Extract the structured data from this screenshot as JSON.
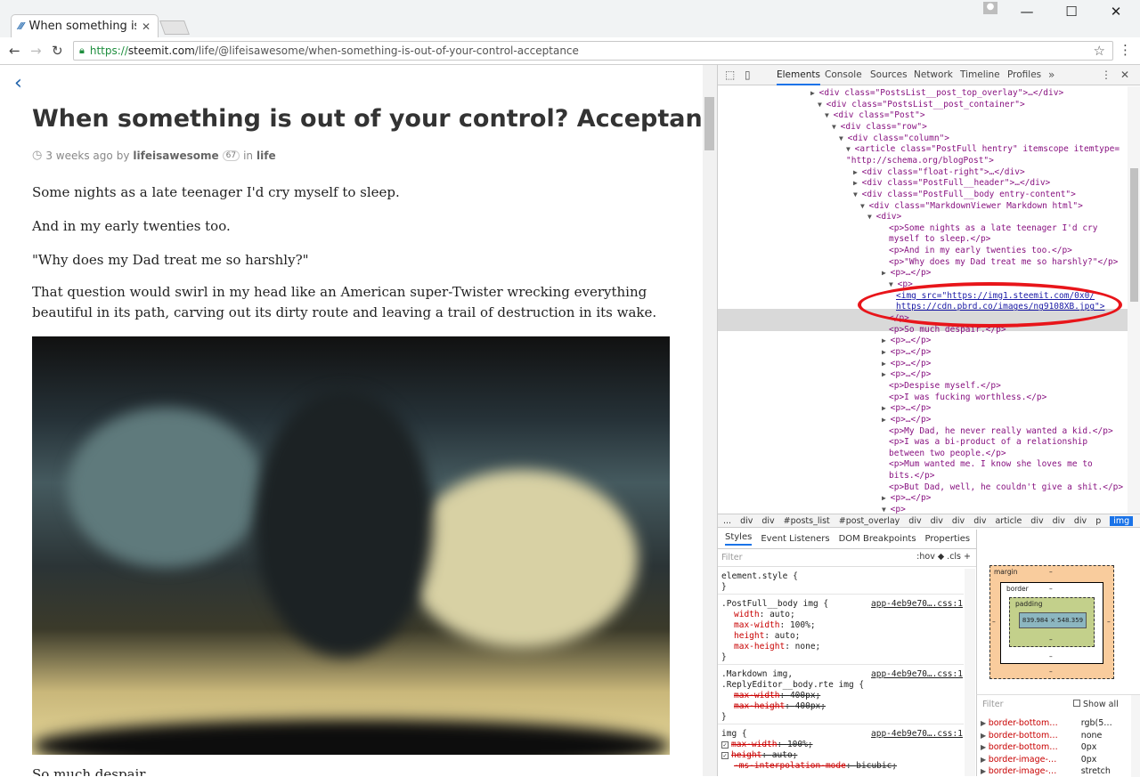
{
  "browser": {
    "tab_title": "When something is",
    "tab_favicon": "steemit-icon",
    "url_scheme": "https://",
    "url_host": "steemit.com",
    "url_path": "/life/@lifeisawesome/when-something-is-out-of-your-control-acceptance"
  },
  "post": {
    "title": "When something is out of your control? Acceptance.",
    "time": "3 weeks ago",
    "by": "by",
    "author": "lifeisawesome",
    "reputation": "67",
    "in": "in",
    "category": "life",
    "paragraphs": [
      "Some nights as a late teenager I'd cry myself to sleep.",
      "And in my early twenties too.",
      "\"Why does my Dad treat me so harshly?\"",
      "That question would swirl in my head like an American super-Twister wrecking everything beautiful in its path, carving out its dirty route and leaving a trail of destruction in its wake."
    ],
    "after_image": "So much despair"
  },
  "devtools": {
    "tabs": [
      "Elements",
      "Console",
      "Sources",
      "Network",
      "Timeline",
      "Profiles"
    ],
    "active_tab": "Elements",
    "dom": [
      {
        "t": "<div class=\"PostsList__post_top_overlay\">…</div>"
      },
      {
        "t": "<div class=\"PostsList__post_container\">"
      },
      {
        "t": "<div class=\"Post\">"
      },
      {
        "t": "<div class=\"row\">"
      },
      {
        "t": "<div class=\"column\">"
      },
      {
        "t": "<article class=\"PostFull hentry\" itemscope itemtype="
      },
      {
        "t": "\"http://schema.org/blogPost\">"
      },
      {
        "t": "<div class=\"float-right\">…</div>"
      },
      {
        "t": "<div class=\"PostFull__header\">…</div>"
      },
      {
        "t": "<div class=\"PostFull__body entry-content\">"
      },
      {
        "t": "<div class=\"MarkdownViewer Markdown html\">"
      },
      {
        "t": "<div>"
      },
      {
        "t": "<p>Some nights as a late teenager I'd cry"
      },
      {
        "t": "myself to sleep.</p>"
      },
      {
        "t": "<p>And in my early twenties too.</p>"
      },
      {
        "t": "<p>\"Why does my Dad treat me so harshly?\"</p>"
      },
      {
        "t": "<p>…</p>"
      },
      {
        "t": "<p>"
      },
      {
        "t": "<img src=\"https://img1.steemit.com/0x0/"
      },
      {
        "t": "https://cdn.pbrd.co/images/ng9108XB.jpg\">"
      },
      {
        "t": "</p>"
      },
      {
        "t": "<p>So much despair.</p>"
      },
      {
        "t": "<p>…</p>"
      },
      {
        "t": "<p>…</p>"
      },
      {
        "t": "<p>…</p>"
      },
      {
        "t": "<p>…</p>"
      },
      {
        "t": "<p>Despise myself.</p>"
      },
      {
        "t": "<p>I was fucking worthless.</p>"
      },
      {
        "t": "<p>…</p>"
      },
      {
        "t": "<p>…</p>"
      },
      {
        "t": "<p>My Dad, he never really wanted a kid.</p>"
      },
      {
        "t": "<p>I was a bi-product of a relationship"
      },
      {
        "t": "between two people.</p>"
      },
      {
        "t": "<p>Mum wanted me. I know she loves me to"
      },
      {
        "t": "bits.</p>"
      },
      {
        "t": "<p>But Dad, well, he couldn't give a shit.</p>"
      },
      {
        "t": "<p>…</p>"
      },
      {
        "t": "<p>"
      }
    ],
    "breadcrumbs": [
      "...",
      "div",
      "div",
      "#posts_list",
      "#post_overlay",
      "div",
      "div",
      "div",
      "div",
      "article",
      "div",
      "div",
      "div",
      "p",
      "img"
    ],
    "subtabs": [
      "Styles",
      "Event Listeners",
      "DOM Breakpoints",
      "Properties"
    ],
    "filter_placeholder": "Filter",
    "filter_tools": ":hov  ◆  .cls  +",
    "styles": [
      {
        "selector": "element.style {",
        "src": ""
      },
      {
        "selector": ".PostFull__body img {",
        "src": "app-4eb9e70….css:1"
      },
      {
        "selector": ".Markdown img,",
        "src": "app-4eb9e70….css:1"
      },
      {
        "selector": ".ReplyEditor__body.rte img {",
        "src": ""
      },
      {
        "selector": "img {",
        "src": "app-4eb9e70….css:1"
      }
    ],
    "props": [
      {
        "n": "width",
        "v": "auto;"
      },
      {
        "n": "max-width",
        "v": "100%;"
      },
      {
        "n": "height",
        "v": "auto;"
      },
      {
        "n": "max-height",
        "v": "none;"
      },
      {
        "n": "max-width",
        "v": "400px;"
      },
      {
        "n": "max-height",
        "v": "400px;"
      },
      {
        "n": "max-width",
        "v": "100%;"
      },
      {
        "n": "height",
        "v": "auto;"
      },
      {
        "n": "-ms-interpolation-mode",
        "v": "bicubic;"
      }
    ],
    "boxmodel": {
      "margin": "margin",
      "border": "border",
      "padding": "padding",
      "dash": "–",
      "content": "839.984 × 548.359"
    },
    "computed_filter": "Filter",
    "show_all": "Show all",
    "computed": [
      {
        "n": "border-bottom…",
        "v": "rgb(5…"
      },
      {
        "n": "border-bottom…",
        "v": "none"
      },
      {
        "n": "border-bottom…",
        "v": "0px"
      },
      {
        "n": "border-image-…",
        "v": "0px"
      },
      {
        "n": "border-image-…",
        "v": "stretch"
      }
    ]
  }
}
